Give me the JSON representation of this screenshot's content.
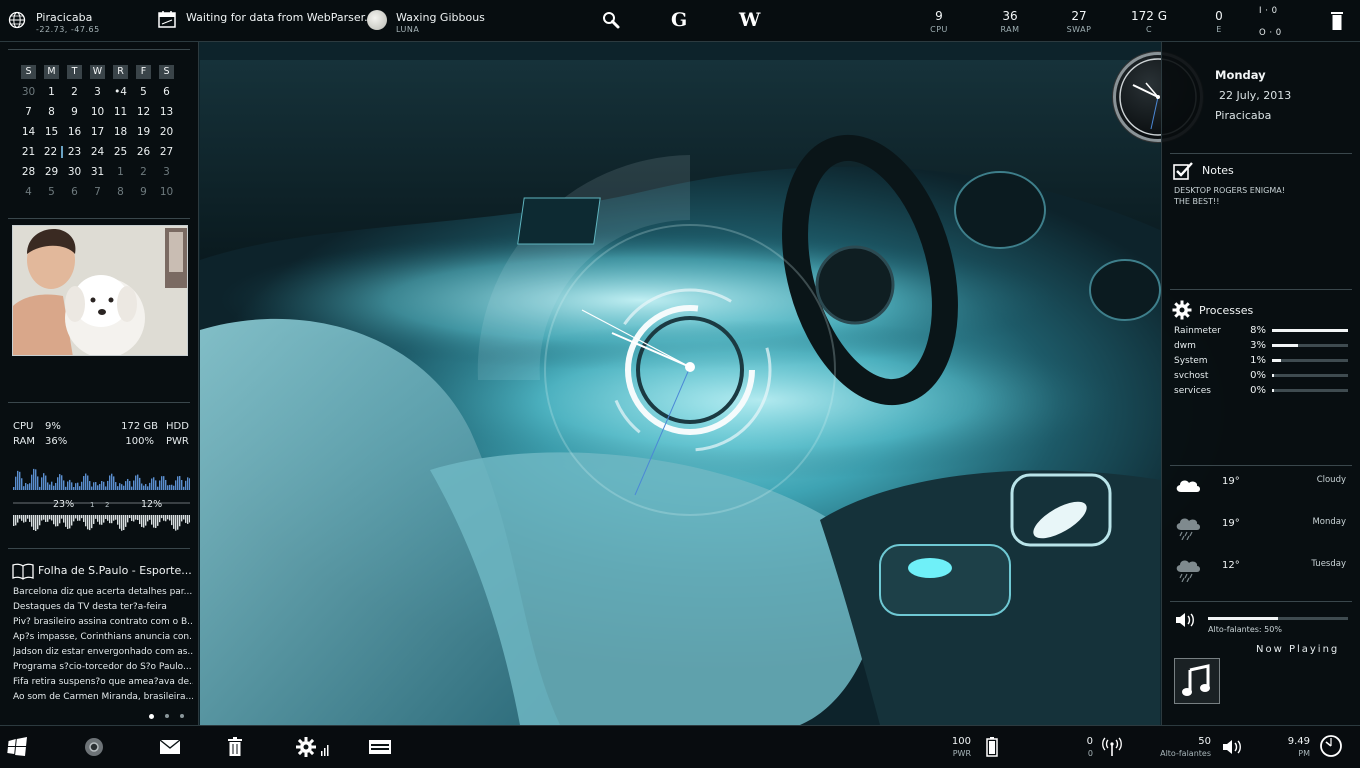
{
  "topbar": {
    "location": {
      "city": "Piracicaba",
      "coords": "-22.73, -47.65"
    },
    "webparser_status": "Waiting for data from WebParser.",
    "moon": {
      "phase": "Waxing Gibbous",
      "label": "LUNA"
    },
    "search_icons": [
      "search-icon",
      "google-icon",
      "wikipedia-icon"
    ],
    "google_letter": "G",
    "wiki_letter": "W",
    "stats": [
      {
        "value": "9",
        "label": "CPU"
      },
      {
        "value": "36",
        "label": "RAM"
      },
      {
        "value": "27",
        "label": "SWAP"
      },
      {
        "value": "172 G",
        "label": "C"
      },
      {
        "value": "0",
        "label": "E"
      }
    ],
    "net_up": "I · 0",
    "net_down": "O · 0"
  },
  "calendar": {
    "weekdays": [
      "S",
      "M",
      "T",
      "W",
      "R",
      "F",
      "S"
    ],
    "weeks": [
      [
        "30",
        "1",
        "2",
        "3",
        "•4",
        "5",
        "6"
      ],
      [
        "7",
        "8",
        "9",
        "10",
        "11",
        "12",
        "13"
      ],
      [
        "14",
        "15",
        "16",
        "17",
        "18",
        "19",
        "20"
      ],
      [
        "21",
        "22",
        "23",
        "24",
        "25",
        "26",
        "27"
      ],
      [
        "28",
        "29",
        "30",
        "31",
        "1",
        "2",
        "3"
      ],
      [
        "4",
        "5",
        "6",
        "7",
        "8",
        "9",
        "10"
      ]
    ]
  },
  "system": {
    "cpu_label": "CPU",
    "cpu_value": "9%",
    "ram_label": "RAM",
    "ram_value": "36%",
    "hdd_value": "172 GB",
    "hdd_label": "HDD",
    "pwr_value": "100%",
    "pwr_label": "PWR",
    "graph_left": "23%",
    "graph_mid_1": "1",
    "graph_mid_2": "2",
    "graph_right": "12%"
  },
  "news": {
    "title": "Folha de S.Paulo - Esporte...",
    "items": [
      "Barcelona diz que acerta detalhes par...",
      "Destaques da TV desta ter?a-feira",
      "Piv? brasileiro assina contrato com o B...",
      "Ap?s impasse, Corinthians anuncia con...",
      "Jadson diz estar envergonhado com as...",
      "Programa s?cio-torcedor do S?o Paulo...",
      "Fifa retira suspens?o que amea?ava de...",
      "Ao som de Carmen Miranda, brasileira..."
    ]
  },
  "date_widget": {
    "weekday": "Monday",
    "date": "22 July, 2013",
    "city": "Piracicaba"
  },
  "notes": {
    "title": "Notes",
    "line1": "DESKTOP ROGERS ENIGMA!",
    "line2": "THE BEST!!"
  },
  "processes": {
    "title": "Processes",
    "items": [
      {
        "name": "Rainmeter",
        "pct": "8%",
        "level": 1.0
      },
      {
        "name": "dwm",
        "pct": "3%",
        "level": 0.34
      },
      {
        "name": "System",
        "pct": "1%",
        "level": 0.12
      },
      {
        "name": "svchost",
        "pct": "0%",
        "level": 0.02
      },
      {
        "name": "services",
        "pct": "0%",
        "level": 0.02
      }
    ]
  },
  "weather": [
    {
      "temp": "19°",
      "desc": "Cloudy",
      "icon": "cloud-sun-icon"
    },
    {
      "temp": "19°",
      "desc": "Monday",
      "icon": "rain-cloud-icon"
    },
    {
      "temp": "12°",
      "desc": "Tuesday",
      "icon": "rain-cloud-icon"
    }
  ],
  "volume": {
    "label": "Alto-falantes: 50%",
    "level": 0.5
  },
  "now_playing": {
    "title": "Now Playing"
  },
  "bottombar": {
    "pwr_value": "100",
    "pwr_label": "PWR",
    "net_up": "0",
    "net_down": "0",
    "vol_value": "50",
    "vol_label": "Alto-falantes",
    "time": "9.49",
    "ampm": "PM"
  }
}
